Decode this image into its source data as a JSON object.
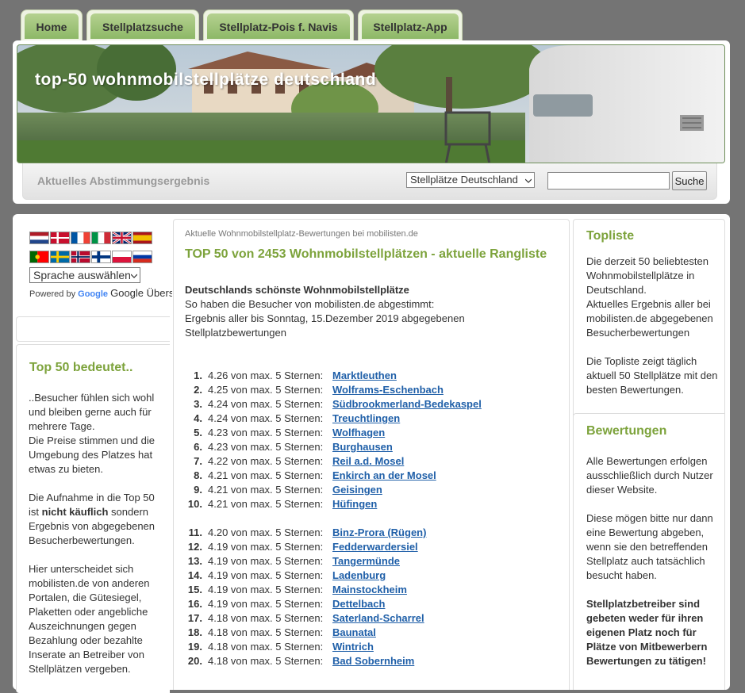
{
  "nav": {
    "tabs": [
      {
        "label": "Home"
      },
      {
        "label": "Stellplatzsuche"
      },
      {
        "label": "Stellplatz-Pois f. Navis"
      },
      {
        "label": "Stellplatz-App"
      }
    ]
  },
  "header": {
    "banner_title": "top-50 wohnmobilstellplätze deutschland",
    "vote_label": "Aktuelles Abstimmungsergebnis",
    "country_select": "Stellplätze Deutschland",
    "search_value": "",
    "search_button": "Suche"
  },
  "language": {
    "flags": [
      "nl",
      "dk",
      "fr",
      "it",
      "gb",
      "es",
      "pt",
      "se",
      "no",
      "fi",
      "pl",
      "ru"
    ],
    "select_label": "Sprache auswählen",
    "powered_by": "Powered by",
    "google": "Google",
    "translate": "Google Übersetzer"
  },
  "left": {
    "box_title": "Top 50 bedeutet..",
    "p1": "..Besucher fühlen sich wohl und bleiben gerne auch für mehrere Tage.",
    "p2": "Die Preise stimmen und die Umgebung des Platzes hat etwas zu bieten.",
    "p3_before": "Die Aufnahme in die Top 50 ist ",
    "p3_bold": "nicht käuflich",
    "p3_after": " sondern Ergebnis von abgegebenen Besucherbewertungen.",
    "p4": "Hier unterscheidet sich mobilisten.de von anderen Portalen, die Gütesiegel, Plaketten oder angebliche Auszeichnungen gegen Bezahlung oder bezahlte Inserate an Betreiber von Stellplätzen vergeben."
  },
  "main": {
    "small_heading": "Aktuelle Wohnmobilstellplatz-Bewertungen bei mobilisten.de",
    "title": "TOP 50 von 2453 Wohnmobilstellplätzen - aktuelle Rangliste",
    "intro_bold": "Deutschlands schönste Wohnmobilstellplätze",
    "intro_line2": "So haben die Besucher von mobilisten.de abgestimmt:",
    "intro_line3": "Ergebnis aller bis Sonntag, 15.Dezember 2019 abgegebenen Stellplatzbewertungen",
    "rankings": [
      {
        "rank": "1.",
        "score": "4.26 von max. 5 Sternen:",
        "place": "Marktleuthen"
      },
      {
        "rank": "2.",
        "score": "4.25 von max. 5 Sternen:",
        "place": "Wolframs-Eschenbach"
      },
      {
        "rank": "3.",
        "score": "4.24 von max. 5 Sternen:",
        "place": "Südbrookmerland-Bedekaspel"
      },
      {
        "rank": "4.",
        "score": "4.24 von max. 5 Sternen:",
        "place": "Treuchtlingen"
      },
      {
        "rank": "5.",
        "score": "4.23 von max. 5 Sternen:",
        "place": "Wolfhagen"
      },
      {
        "rank": "6.",
        "score": "4.23 von max. 5 Sternen:",
        "place": "Burghausen"
      },
      {
        "rank": "7.",
        "score": "4.22 von max. 5 Sternen:",
        "place": "Reil a.d. Mosel"
      },
      {
        "rank": "8.",
        "score": "4.21 von max. 5 Sternen:",
        "place": "Enkirch an der Mosel"
      },
      {
        "rank": "9.",
        "score": "4.21 von max. 5 Sternen:",
        "place": "Geisingen"
      },
      {
        "rank": "10.",
        "score": "4.21 von max. 5 Sternen:",
        "place": "Hüfingen"
      },
      {
        "rank": "11.",
        "score": "4.20 von max. 5 Sternen:",
        "place": "Binz-Prora (Rügen)"
      },
      {
        "rank": "12.",
        "score": "4.19 von max. 5 Sternen:",
        "place": "Fedderwardersiel"
      },
      {
        "rank": "13.",
        "score": "4.19 von max. 5 Sternen:",
        "place": "Tangermünde"
      },
      {
        "rank": "14.",
        "score": "4.19 von max. 5 Sternen:",
        "place": "Ladenburg"
      },
      {
        "rank": "15.",
        "score": "4.19 von max. 5 Sternen:",
        "place": "Mainstockheim"
      },
      {
        "rank": "16.",
        "score": "4.19 von max. 5 Sternen:",
        "place": "Dettelbach"
      },
      {
        "rank": "17.",
        "score": "4.18 von max. 5 Sternen:",
        "place": "Saterland-Scharrel"
      },
      {
        "rank": "18.",
        "score": "4.18 von max. 5 Sternen:",
        "place": "Baunatal"
      },
      {
        "rank": "19.",
        "score": "4.18 von max. 5 Sternen:",
        "place": "Wintrich"
      },
      {
        "rank": "20.",
        "score": "4.18 von max. 5 Sternen:",
        "place": "Bad Sobernheim"
      }
    ]
  },
  "right": {
    "topliste_title": "Topliste",
    "topliste_text1": "Die derzeit 50 beliebtesten Wohnmobilstellplätze in Deutschland.",
    "topliste_text2": "Aktuelles Ergebnis aller bei mobilisten.de abgegebenen Besucherbewertungen",
    "topliste_text3": "Die Topliste zeigt täglich aktuell 50 Stellplätze mit den besten Bewertungen.",
    "bewertungen_title": "Bewertungen",
    "bewertungen_text1": "Alle Bewertungen erfolgen ausschließlich durch Nutzer dieser Website.",
    "bewertungen_text2": "Diese mögen bitte nur dann eine Bewertung abgeben, wenn sie den betreffenden Stellplatz auch tatsächlich besucht haben.",
    "bewertungen_bold": "Stellplatzbetreiber sind gebeten weder für ihren eigenen Platz noch für Plätze von Mitbewerbern Bewertungen zu tätigen!"
  }
}
